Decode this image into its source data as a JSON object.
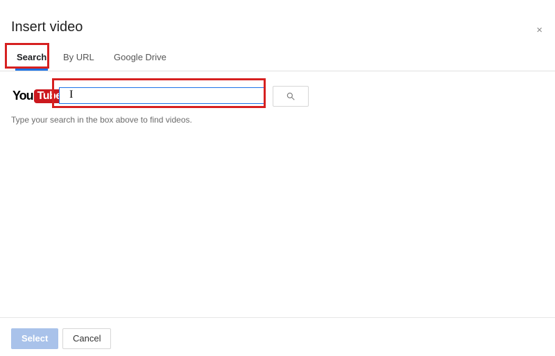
{
  "dialog": {
    "title": "Insert video",
    "close_label": "×"
  },
  "tabs": {
    "search": "Search",
    "by_url": "By URL",
    "drive": "Google Drive"
  },
  "logo": {
    "you": "You",
    "tube": "Tube"
  },
  "search": {
    "value": "",
    "placeholder": ""
  },
  "instruction": "Type your search in the box above to find videos.",
  "footer": {
    "select": "Select",
    "cancel": "Cancel"
  }
}
